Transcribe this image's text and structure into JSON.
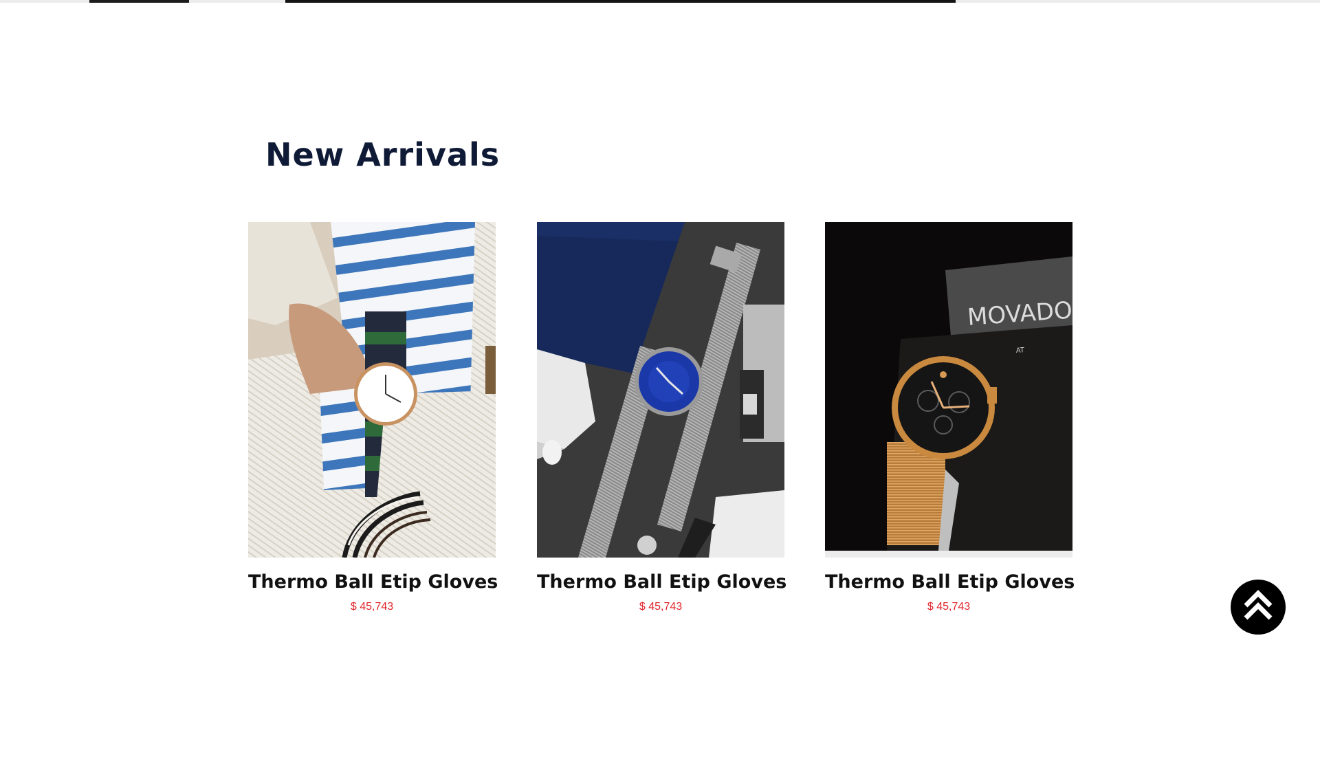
{
  "section": {
    "title": "New Arrivals"
  },
  "products": [
    {
      "name": "Thermo Ball Etip Gloves",
      "price": "$ 45,743",
      "image": "watch-on-wrist-photo"
    },
    {
      "name": "Thermo Ball Etip Gloves",
      "price": "$ 45,743",
      "image": "blue-dial-mesh-watch-photo"
    },
    {
      "name": "Thermo Ball Etip Gloves",
      "price": "$ 45,743",
      "image": "gold-movado-watch-photo"
    }
  ],
  "photo_text": {
    "brand_box": "MOVADO",
    "brand_sub": "AT"
  },
  "colors": {
    "title": "#0f1b36",
    "price": "#e0262b",
    "scroll_button": "#000000"
  },
  "icons": {
    "scroll_top": "double-chevron-up-icon"
  }
}
